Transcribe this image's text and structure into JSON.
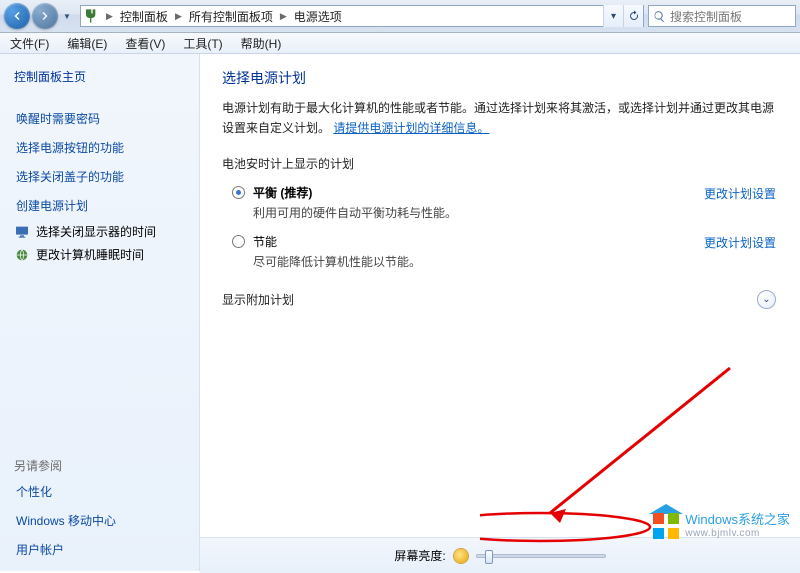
{
  "nav": {
    "back_icon": "back",
    "forward_icon": "forward"
  },
  "breadcrumb": {
    "items": [
      "控制面板",
      "所有控制面板项",
      "电源选项"
    ]
  },
  "search": {
    "placeholder": "搜索控制面板"
  },
  "menubar": {
    "file": "文件(F)",
    "edit": "编辑(E)",
    "view": "查看(V)",
    "tools": "工具(T)",
    "help": "帮助(H)"
  },
  "sidebar": {
    "home": "控制面板主页",
    "links": [
      "唤醒时需要密码",
      "选择电源按钮的功能",
      "选择关闭盖子的功能",
      "创建电源计划"
    ],
    "icon_links": [
      {
        "icon": "monitor",
        "label": "选择关闭显示器的时间"
      },
      {
        "icon": "globe",
        "label": "更改计算机睡眠时间"
      }
    ],
    "see_also": "另请参阅",
    "see_also_links": [
      "个性化",
      "Windows 移动中心",
      "用户帐户"
    ]
  },
  "content": {
    "heading": "选择电源计划",
    "desc_prefix": "电源计划有助于最大化计算机的性能或者节能。通过选择计划来将其激活，或选择计划并通过更改其电源设置来自定义计划。",
    "desc_link": "请提供电源计划的详细信息。",
    "group_label": "电池安时计上显示的计划",
    "plans": [
      {
        "selected": true,
        "title": "平衡 (推荐)",
        "title_bold": true,
        "subtitle": "利用可用的硬件自动平衡功耗与性能。",
        "change": "更改计划设置"
      },
      {
        "selected": false,
        "title": "节能",
        "title_bold": false,
        "subtitle": "尽可能降低计算机性能以节能。",
        "change": "更改计划设置"
      }
    ],
    "expand_label": "显示附加计划"
  },
  "bottom": {
    "brightness_label": "屏幕亮度:",
    "slider_percent": 8
  },
  "watermark": {
    "line1_en": "Windows",
    "line1_cn": "系统之家",
    "line2": "www.bjmlv.com"
  }
}
